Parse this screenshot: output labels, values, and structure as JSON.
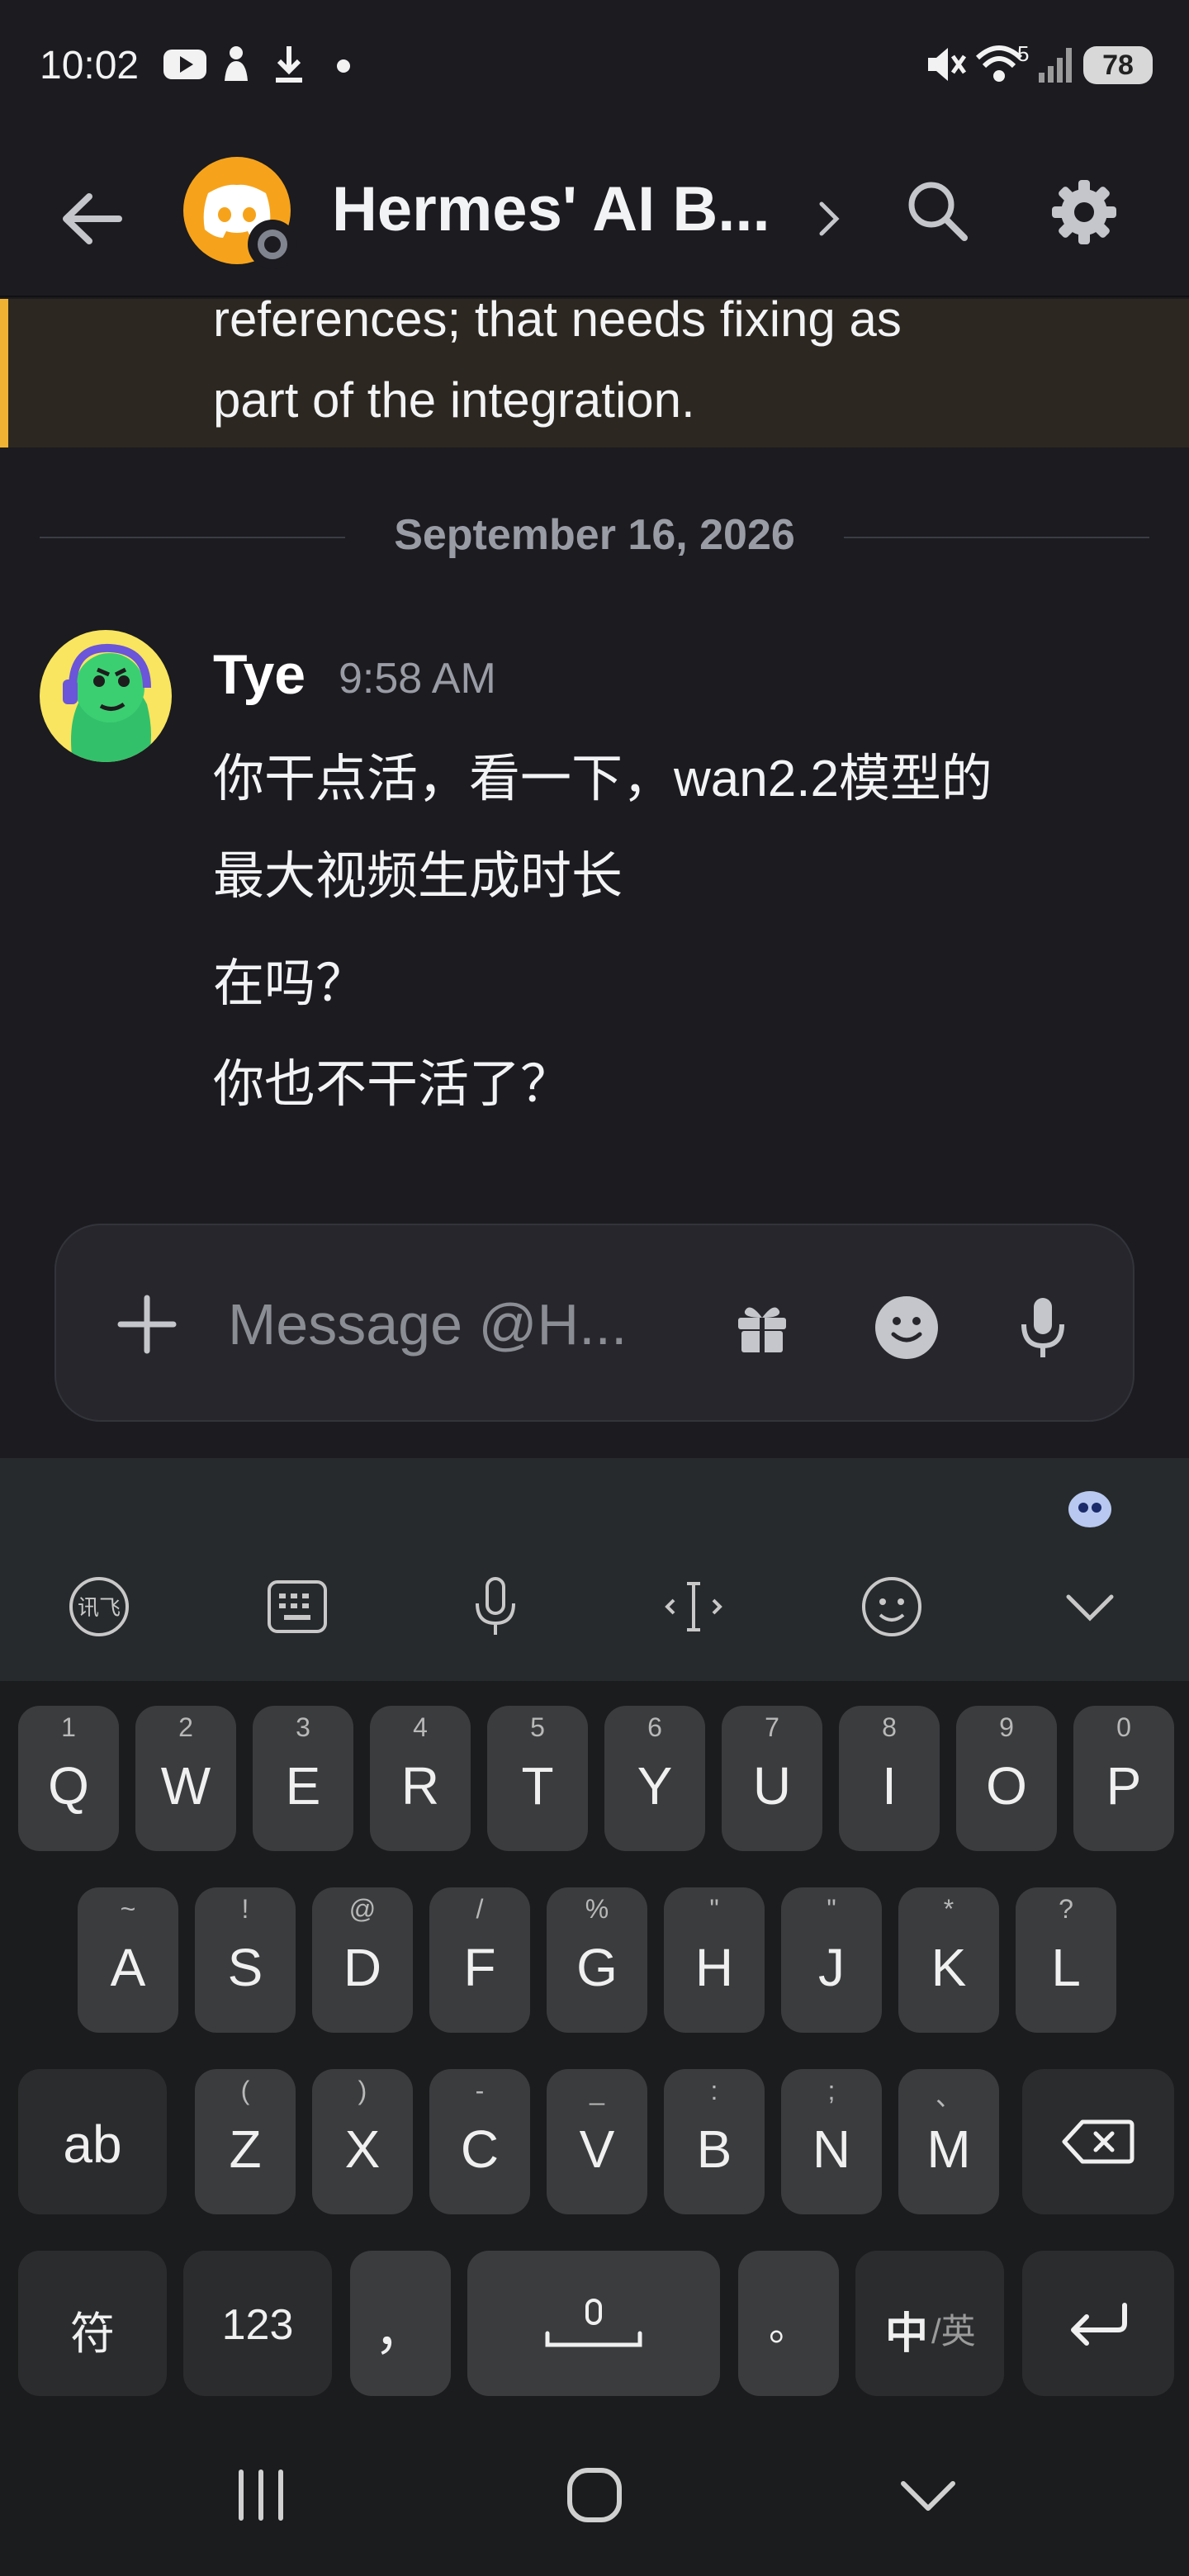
{
  "status_bar": {
    "time": "10:02",
    "battery": "78",
    "signal_strength": "5"
  },
  "header": {
    "title": "Hermes' AI B...",
    "accent": "#f6a31b"
  },
  "highlight": {
    "lines": [
      "references; that needs fixing as",
      "part of the integration."
    ],
    "accent": "#f0b232"
  },
  "date_divider": "September 16, 2026",
  "message": {
    "username": "Tye",
    "timestamp": "9:58 AM",
    "lines": [
      "你干点活，看一下，wan2.2模型的",
      "最大视频生成时长",
      "在吗？",
      "你也不干活了？"
    ]
  },
  "composer": {
    "placeholder": "Message @H..."
  },
  "keyboard": {
    "row1": [
      {
        "hint": "1",
        "label": "Q"
      },
      {
        "hint": "2",
        "label": "W"
      },
      {
        "hint": "3",
        "label": "E"
      },
      {
        "hint": "4",
        "label": "R"
      },
      {
        "hint": "5",
        "label": "T"
      },
      {
        "hint": "6",
        "label": "Y"
      },
      {
        "hint": "7",
        "label": "U"
      },
      {
        "hint": "8",
        "label": "I"
      },
      {
        "hint": "9",
        "label": "O"
      },
      {
        "hint": "0",
        "label": "P"
      }
    ],
    "row2": [
      {
        "hint": "~",
        "label": "A"
      },
      {
        "hint": "!",
        "label": "S"
      },
      {
        "hint": "@",
        "label": "D"
      },
      {
        "hint": "/",
        "label": "F"
      },
      {
        "hint": "%",
        "label": "G"
      },
      {
        "hint": "\"",
        "label": "H"
      },
      {
        "hint": "\"",
        "label": "J"
      },
      {
        "hint": "*",
        "label": "K"
      },
      {
        "hint": "?",
        "label": "L"
      }
    ],
    "row3": [
      {
        "hint": "(",
        "label": "Z"
      },
      {
        "hint": ")",
        "label": "X"
      },
      {
        "hint": "-",
        "label": "C"
      },
      {
        "hint": "_",
        "label": "V"
      },
      {
        "hint": ":",
        "label": "B"
      },
      {
        "hint": ";",
        "label": "N"
      },
      {
        "hint": "、",
        "label": "M"
      }
    ],
    "shift_label": "ab",
    "symbols_label": "符",
    "numbers_label": "123",
    "comma_label": "，",
    "period_label": "。",
    "lang_primary": "中",
    "lang_secondary": "/英"
  }
}
